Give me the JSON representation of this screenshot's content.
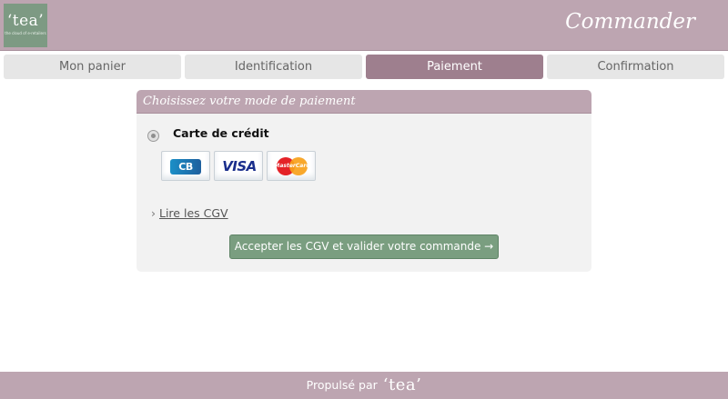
{
  "header": {
    "logo_text": "‘tea’",
    "logo_tagline": "the cloud of e-retailers",
    "title": "Commander"
  },
  "steps": [
    {
      "label": "Mon panier",
      "active": false
    },
    {
      "label": "Identification",
      "active": false
    },
    {
      "label": "Paiement",
      "active": true
    },
    {
      "label": "Confirmation",
      "active": false
    }
  ],
  "payment": {
    "heading": "Choisissez votre mode de paiement",
    "method_label": "Carte de crédit",
    "method_selected": true,
    "cards": [
      {
        "name": "CB",
        "icon": "cb-card-icon"
      },
      {
        "name": "VISA",
        "icon": "visa-card-icon"
      },
      {
        "name": "MasterCard",
        "icon": "mastercard-card-icon"
      }
    ],
    "cgv_chevron": "›",
    "cgv_link": "Lire les CGV",
    "submit_label": "Accepter les CGV et valider votre commande →"
  },
  "footer": {
    "prefix": "Propulsé par",
    "logo_text": "‘tea’"
  },
  "colors": {
    "brand_mauve": "#bda5b1",
    "active_step": "#9e7f8e",
    "submit_green": "#7a9e80",
    "logo_green": "#7d9a83"
  }
}
